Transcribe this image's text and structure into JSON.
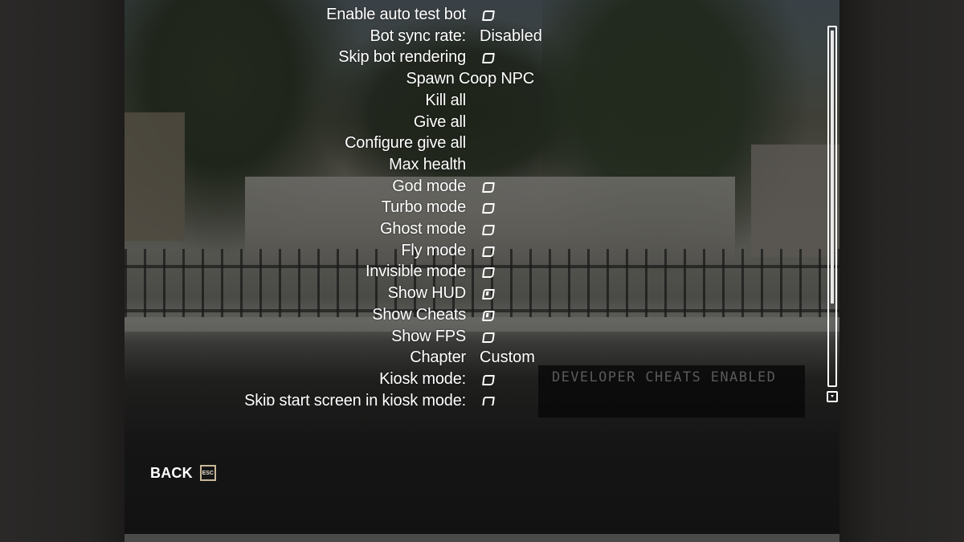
{
  "menu": {
    "items": [
      {
        "label": "Enable auto test bot",
        "control": "checkbox",
        "checked": false
      },
      {
        "label": "Bot sync rate:",
        "control": "value",
        "value": "Disabled"
      },
      {
        "label": "Skip bot rendering",
        "control": "checkbox",
        "checked": false
      },
      {
        "label": "Spawn Coop NPC",
        "control": "button"
      },
      {
        "label": "Kill all",
        "control": "button"
      },
      {
        "label": "Give all",
        "control": "button"
      },
      {
        "label": "Configure give all",
        "control": "button"
      },
      {
        "label": "Max health",
        "control": "button"
      },
      {
        "label": "God mode",
        "control": "checkbox",
        "checked": false
      },
      {
        "label": "Turbo mode",
        "control": "checkbox",
        "checked": false
      },
      {
        "label": "Ghost mode",
        "control": "checkbox",
        "checked": false
      },
      {
        "label": "Fly mode",
        "control": "checkbox",
        "checked": false
      },
      {
        "label": "Invisible mode",
        "control": "checkbox",
        "checked": false
      },
      {
        "label": "Show HUD",
        "control": "checkbox",
        "checked": true
      },
      {
        "label": "Show Cheats",
        "control": "checkbox",
        "checked": true
      },
      {
        "label": "Show FPS",
        "control": "checkbox",
        "checked": false
      },
      {
        "label": "Chapter",
        "control": "value",
        "value": "Custom"
      },
      {
        "label": "Kiosk mode:",
        "control": "checkbox",
        "checked": false
      },
      {
        "label": "Skip start screen in kiosk mode:",
        "control": "checkbox",
        "checked": false
      }
    ]
  },
  "status": {
    "cheats_banner": "DEVELOPER CHEATS ENABLED"
  },
  "footer": {
    "back_label": "BACK",
    "back_key": "ESC"
  },
  "scrollbar": {
    "position_fraction": 0.0,
    "visible_fraction": 0.76,
    "down_arrow_icon": "triangle-down"
  },
  "colors": {
    "text": "#ffffff",
    "banner_text": "#5a5a5a",
    "esc_border": "#c9b89a"
  }
}
